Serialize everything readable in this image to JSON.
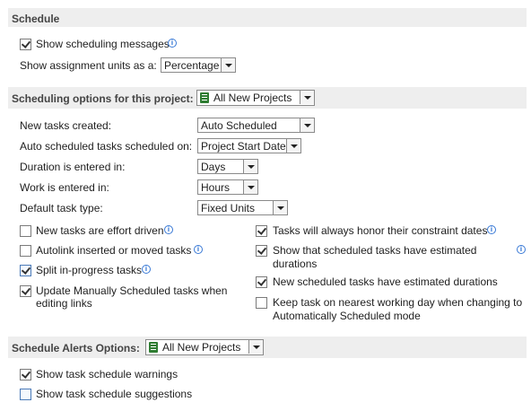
{
  "schedule": {
    "header": "Schedule",
    "show_messages_label": "Show scheduling messages",
    "show_messages_checked": true,
    "assignment_units_label": "Show assignment units as a:",
    "assignment_units_value": "Percentage"
  },
  "options": {
    "header": "Scheduling options for this project:",
    "project_value": "All New Projects",
    "new_tasks_label": "New tasks created:",
    "new_tasks_value": "Auto Scheduled",
    "auto_scheduled_label": "Auto scheduled tasks scheduled on:",
    "auto_scheduled_value": "Project Start Date",
    "duration_label": "Duration is entered in:",
    "duration_value": "Days",
    "work_label": "Work is entered in:",
    "work_value": "Hours",
    "task_type_label": "Default task type:",
    "task_type_value": "Fixed Units",
    "left_checks": [
      {
        "label": "New tasks are effort driven",
        "checked": false
      },
      {
        "label": "Autolink inserted or moved tasks",
        "checked": false
      },
      {
        "label": "Split in-progress tasks",
        "checked": true
      },
      {
        "label": "Update Manually Scheduled tasks when",
        "label2": "editing links",
        "checked": true
      }
    ],
    "right_checks": [
      {
        "label": "Tasks will always honor their constraint dates",
        "checked": true
      },
      {
        "label": "Show that scheduled tasks have estimated",
        "label2": "durations",
        "checked": true
      },
      {
        "label": "New scheduled tasks have estimated durations",
        "checked": true
      },
      {
        "label": "Keep task on nearest working day when changing to",
        "label2": "Automatically Scheduled mode",
        "checked": false
      }
    ]
  },
  "alerts": {
    "header": "Schedule Alerts Options:",
    "project_value": "All New Projects",
    "warnings_label": "Show task schedule warnings",
    "warnings_checked": true,
    "suggestions_label": "Show task schedule suggestions",
    "suggestions_checked": false
  }
}
